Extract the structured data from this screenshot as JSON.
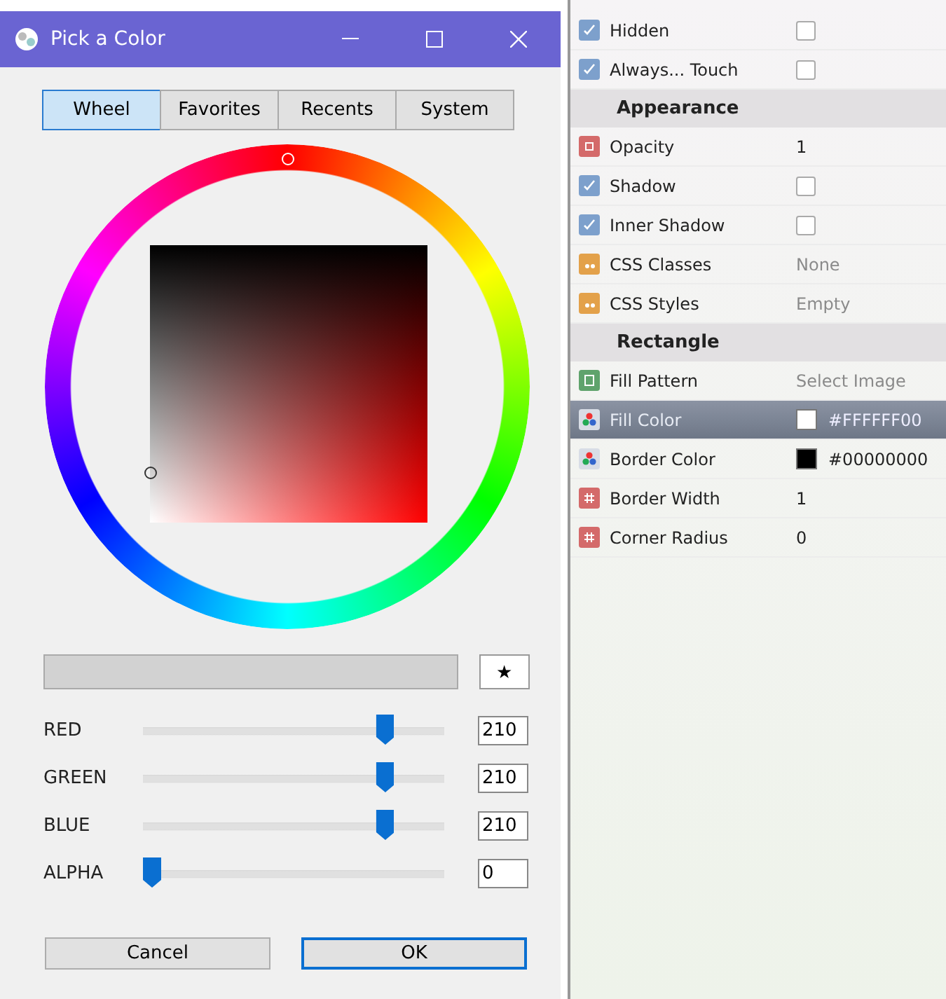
{
  "dialog": {
    "title": "Pick a Color",
    "tabs": [
      {
        "label": "Wheel",
        "selected": true
      },
      {
        "label": "Favorites",
        "selected": false
      },
      {
        "label": "Recents",
        "selected": false
      },
      {
        "label": "System",
        "selected": false
      }
    ],
    "favorite_button": "★",
    "sliders": [
      {
        "label": "RED",
        "level": 0.82,
        "value": "210"
      },
      {
        "label": "GREEN",
        "level": 0.82,
        "value": "210"
      },
      {
        "label": "BLUE",
        "level": 0.82,
        "value": "210"
      },
      {
        "label": "ALPHA",
        "level": 0,
        "value": "0"
      }
    ],
    "buttons": [
      {
        "label": "Cancel",
        "default": false
      },
      {
        "label": "OK",
        "default": true
      }
    ]
  },
  "properties": [
    {
      "kind": "boolean",
      "label": "Hidden",
      "checked": false,
      "selected": false
    },
    {
      "kind": "boolean",
      "label": "Always... Touch",
      "checked": false,
      "selected": false
    },
    {
      "kind": "header",
      "label": "Appearance"
    },
    {
      "kind": "decimal",
      "label": "Opacity",
      "value": "1",
      "selected": false
    },
    {
      "kind": "boolean",
      "label": "Shadow",
      "checked": false,
      "selected": false
    },
    {
      "kind": "boolean",
      "label": "Inner Shadow",
      "checked": false,
      "selected": false
    },
    {
      "kind": "string",
      "label": "CSS Classes",
      "placeholder": "None",
      "selected": false
    },
    {
      "kind": "string",
      "label": "CSS Styles",
      "placeholder": "Empty",
      "selected": false
    },
    {
      "kind": "header",
      "label": "Rectangle"
    },
    {
      "kind": "image",
      "label": "Fill Pattern",
      "placeholder": "Select Image",
      "selected": false
    },
    {
      "kind": "color",
      "label": "Fill Color",
      "value": "#FFFFFF00",
      "color": "#ffffff",
      "selected": true
    },
    {
      "kind": "color",
      "label": "Border Color",
      "value": "#00000000",
      "color": "#000000",
      "selected": false
    },
    {
      "kind": "integer",
      "label": "Border Width",
      "value": "1",
      "selected": false
    },
    {
      "kind": "integer",
      "label": "Corner Radius",
      "value": "0",
      "selected": false
    }
  ]
}
